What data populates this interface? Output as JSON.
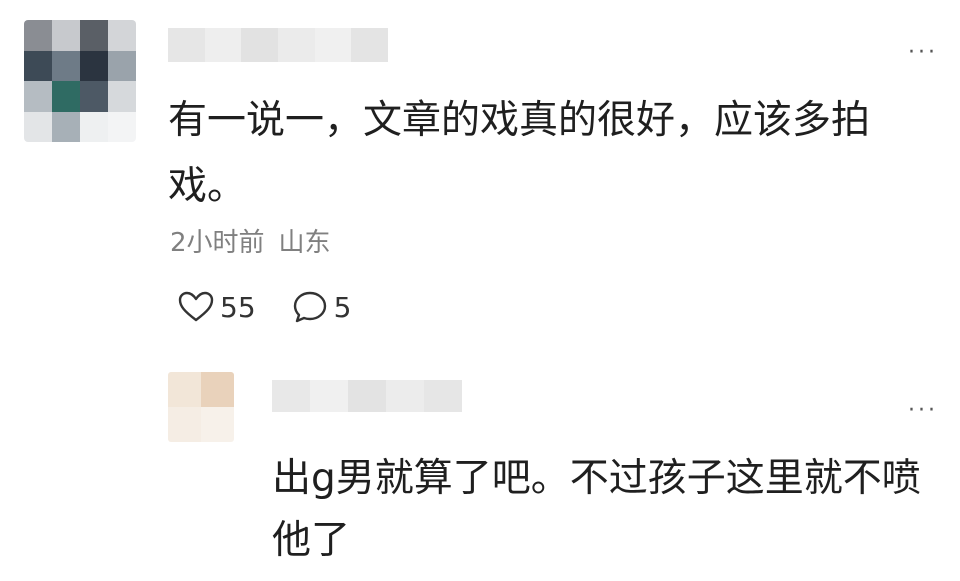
{
  "comment": {
    "text": "有一说一，文章的戏真的很好，应该多拍戏。",
    "time": "2小时前",
    "location": "山东",
    "likes": "55",
    "replies": "5",
    "more_icon": "more-icon",
    "like_icon": "heart-icon",
    "reply_icon": "comment-bubble-icon"
  },
  "reply": {
    "text": "出g男就算了吧。不过孩子这里就不喷他了",
    "more_icon": "more-icon"
  },
  "colors": {
    "text": "#1f1f1f",
    "meta": "#808080",
    "avatar_blur": [
      "#8a8d93",
      "#c7c9cd",
      "#5a5f66",
      "#d3d5d8",
      "#3d4a56",
      "#6e7b87",
      "#2b3440",
      "#9aa3ab",
      "#b5bcc2",
      "#2f6b63",
      "#4d5965",
      "#d6d9dc",
      "#e3e5e7",
      "#a7b0b7",
      "#eef0f1",
      "#f3f4f5"
    ],
    "reply_avatar_blur": [
      "#f2e6d8",
      "#e9d2bb",
      "#f5ede4",
      "#f7f1ea"
    ]
  }
}
